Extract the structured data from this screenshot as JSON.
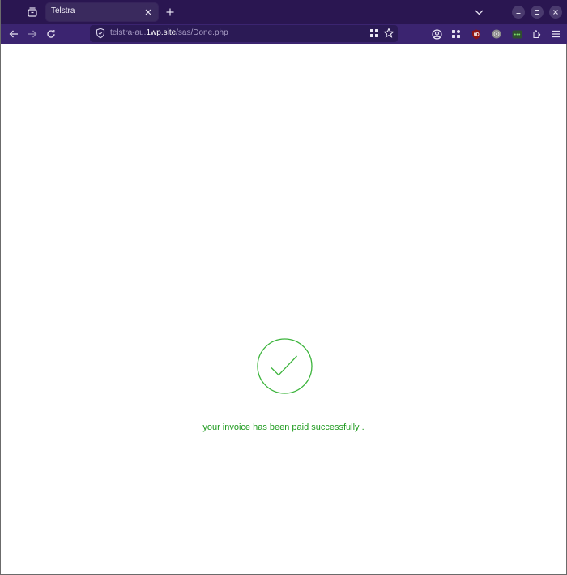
{
  "tab": {
    "title": "Telstra"
  },
  "urlbar": {
    "prefix": "telstra-au.",
    "domain": "1wp.site",
    "path": "/sas/Done.php"
  },
  "page": {
    "message": "your invoice has been paid successfully ."
  },
  "colors": {
    "tabbar_bg": "#2a1651",
    "navbar_bg": "#3b2470",
    "success_green": "#1e9a1e",
    "check_circle": "#3cb43c"
  },
  "icons": [
    "tab-view-icon",
    "close-icon",
    "plus-icon",
    "chevron-down-icon",
    "minimize-icon",
    "maximize-icon",
    "close-window-icon",
    "back-arrow-icon",
    "forward-arrow-icon",
    "reload-icon",
    "shield-icon",
    "grid-icon",
    "star-icon",
    "account-icon",
    "extension-icon",
    "ublock-icon",
    "puzzle-icon",
    "hamburger-menu-icon",
    "checkmark-icon"
  ]
}
